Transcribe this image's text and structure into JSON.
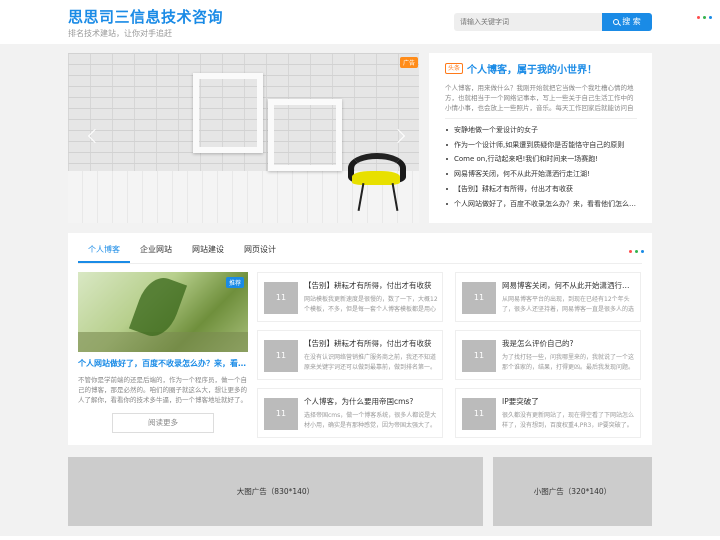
{
  "header": {
    "title": "思思司三信息技术咨询",
    "subtitle": "排名技术建站，让你对手追赶",
    "search_placeholder": "请输入关键字词",
    "search_button": "搜 索",
    "dot_colors": [
      "#ff4d4d",
      "#33b24d",
      "#1a8be6"
    ]
  },
  "slider": {
    "ad_label": "广告",
    "active_dot": 2
  },
  "feature": {
    "tag": "头条",
    "title": "个人博客，属于我的小世界！",
    "description": "个人博客，用来做什么？我刚开始就把它当做一个我吐槽心情的地方，也就相当于一个网络记事本，写上一些关于自己生活工作中的小情小事，也会放上一些照片，音乐。每天工作回家后就能访问自己的网站，一边听着音乐，一边写写文章。",
    "list": [
      "安静地做一个爱设计的女子",
      "作为一个设计师,如果遭到质疑你是否能恪守自己的原则",
      "Come on,行动起来吧!我们和时间来一场赛跑!",
      "网易博客关闭，何不从此开始潇洒行走江湖!",
      "【告别】耕耘才有所得，付出才有收获",
      "个人网站做好了，百度不收录怎么办？来，看看他们怎么做的。"
    ]
  },
  "tabs": {
    "items": [
      "个人博客",
      "企业网站",
      "网站建设",
      "网页设计"
    ],
    "active": 0,
    "dot_colors": [
      "#ff4d4d",
      "#33b24d",
      "#1a8be6"
    ]
  },
  "featured_post": {
    "badge": "推荐",
    "title": "个人网站做好了，百度不收录怎么办？来，看看他们怎么做的。",
    "description": "不管你是学前端的还是后端的，作为一个程序员，做一个自己的博客，那是必然的。咱们的圈子就这么大，想让更多的人了解你，看看你的技术多牛逼，扔一个博客地址就好了。",
    "more_label": "阅读更多"
  },
  "grid_posts": [
    {
      "thumb": "11",
      "title": "【告别】耕耘才有所得，付出才有收获",
      "desc": "网站模板我更新速度是很慢的，数了一下，大概12个模板，不多，但是每一套个人博客模板都是用心之作。"
    },
    {
      "thumb": "11",
      "title": "网易博客关闭，何不从此开始潇洒行走江湖!",
      "desc": "从网易博客平台的出现，到现在已经有12个年头了，很多人还坚持着，网易博客一直是很多人的选择。"
    },
    {
      "thumb": "11",
      "title": "【告别】耕耘才有所得，付出才有收获",
      "desc": "在没有认识网络营销推广服务商之前，我还不知道原来关键字词还可以做到最靠前，做到排名第一。"
    },
    {
      "thumb": "11",
      "title": "我是怎么评价自己的?",
      "desc": "为了找打轻一些，问我哪里来的，我就说了一个这那个谁家的，结果，打得更凶。最后我发现问题。"
    },
    {
      "thumb": "11",
      "title": "个人博客，为什么要用帝国cms?",
      "desc": "选择帝国cms，做一个博客系统，很多人都说是大材小用，确实是有那种感觉，因为帝国太强大了。"
    },
    {
      "thumb": "11",
      "title": "IP要突破了",
      "desc": "很久都没有更新网站了，现在得空看了下网站怎么样了，没有想到，百度权重4,PR3，IP要突破了。"
    }
  ],
  "ads": {
    "big": "大图广告（830*140）",
    "small": "小图广告（320*140）"
  }
}
